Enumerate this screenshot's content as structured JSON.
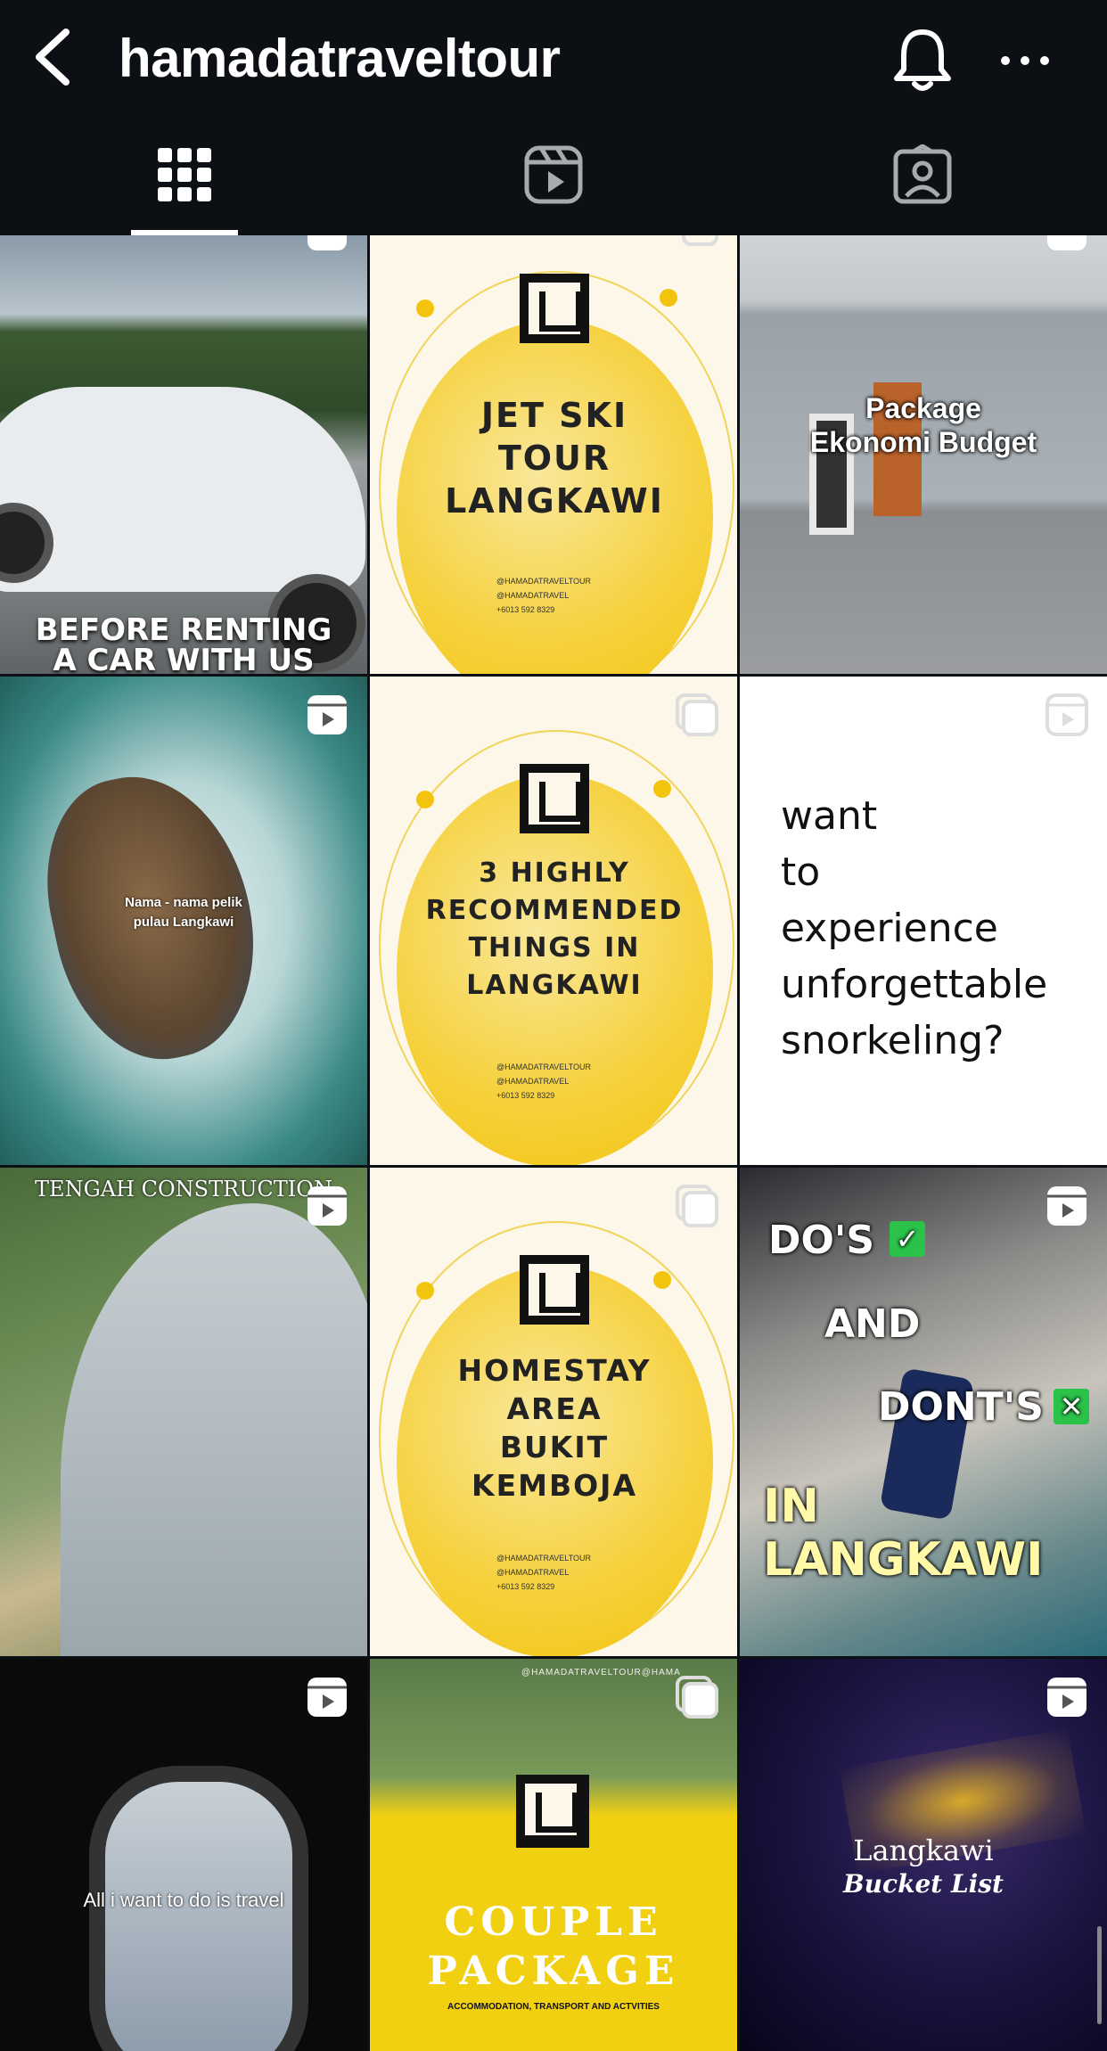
{
  "header": {
    "username": "hamadatraveltour"
  },
  "tabs": [
    {
      "name": "posts-grid",
      "active": true
    },
    {
      "name": "reels",
      "active": false
    },
    {
      "name": "tagged",
      "active": false
    }
  ],
  "posts": [
    {
      "type": "reel",
      "caption": "BEFORE RENTING\nA CAR WITH US"
    },
    {
      "type": "carousel",
      "title": "JET SKI\nTOUR\nLANGKAWI",
      "social": [
        "@HAMADATRAVELTOUR",
        "@HAMADATRAVEL",
        "+6013 592 8329"
      ]
    },
    {
      "type": "reel",
      "caption": "Package\nEkonomi Budget"
    },
    {
      "type": "reel",
      "caption": "Nama - nama pelik\npulau Langkawi"
    },
    {
      "type": "carousel",
      "title": "3 HIGHLY\nRECOMMENDED\nTHINGS IN\nLANGKAWI",
      "social": [
        "@HAMADATRAVELTOUR",
        "@HAMADATRAVEL",
        "+6013 592 8329"
      ]
    },
    {
      "type": "reel",
      "caption": "want\nto\nexperience\nunforgettable\nsnorkeling?"
    },
    {
      "type": "reel",
      "caption": "TENGAH CONSTRUCTION"
    },
    {
      "type": "carousel",
      "title": "HOMESTAY\nAREA\nBUKIT\nKEMBOJA",
      "social": [
        "@HAMADATRAVELTOUR",
        "@HAMADATRAVEL",
        "+6013 592 8329"
      ]
    },
    {
      "type": "reel",
      "caption_lines": [
        "DO'S",
        "AND",
        "DONT'S",
        "IN LANGKAWI"
      ]
    },
    {
      "type": "reel",
      "caption": "All i want to do is travel"
    },
    {
      "type": "carousel",
      "title": "COUPLE\nPACKAGE",
      "subtitle": "ACCOMMODATION, TRANSPORT AND ACTVITIES",
      "watermark": "@HAMADATRAVELTOUR@HAMA"
    },
    {
      "type": "reel",
      "caption_lines": [
        "Langkawi",
        "Bucket List"
      ]
    }
  ]
}
